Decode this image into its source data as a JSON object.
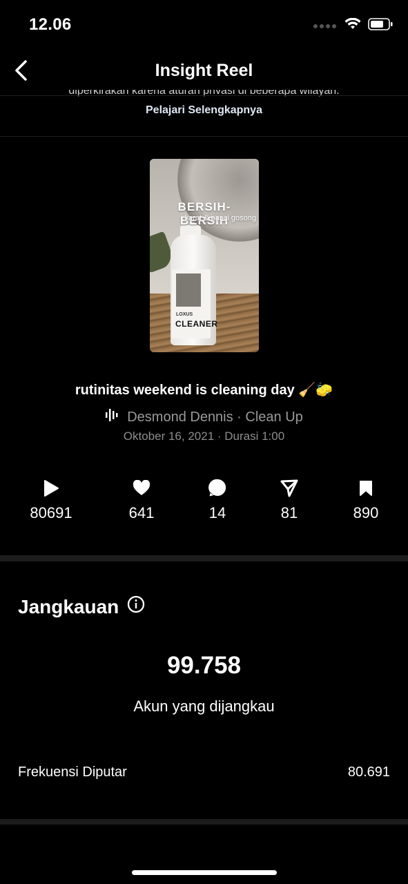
{
  "status_bar": {
    "time": "12.06"
  },
  "nav": {
    "title": "Insight Reel"
  },
  "notice": {
    "text": "diperkirakan karena aturan privasi di beberapa wilayah.",
    "link": "Pelajari Selengkapnya"
  },
  "thumbnail": {
    "title_text": "BERSIH-BERSIH",
    "subtitle_text": "karat & panci gosong",
    "brand_small": "LOXUS",
    "brand_big": "CLEANER"
  },
  "reel": {
    "caption": "rutinitas weekend is cleaning day 🧹🧽",
    "audio": "Desmond Dennis · Clean Up",
    "meta": "Oktober 16, 2021 · Durasi 1:00"
  },
  "stats": {
    "plays": "80691",
    "likes": "641",
    "comments": "14",
    "shares": "81",
    "saves": "890"
  },
  "reach": {
    "title": "Jangkauan",
    "value": "99.758",
    "label": "Akun yang dijangkau",
    "rows": [
      {
        "label": "Frekuensi Diputar",
        "value": "80.691"
      }
    ]
  }
}
